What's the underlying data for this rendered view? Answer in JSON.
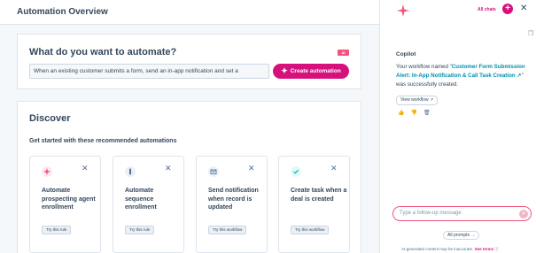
{
  "main": {
    "title": "Automation Overview",
    "automate_card": {
      "title": "What do you want to automate?",
      "ai_badge": "AI",
      "prompt_value": "When an existing customer submits a form, send an in-app notification and set a",
      "create_button": "Create automation"
    },
    "discover": {
      "title": "Discover",
      "subtitle": "Get started with these recommended automations",
      "cards": [
        {
          "label": "Automate prospecting agent enrollment",
          "button": "Try this rule",
          "icon": "sparkle-icon",
          "icon_color": "#f2547d"
        },
        {
          "label": "Automate sequence enrollment",
          "button": "Try this rule",
          "icon": "sequence-icon",
          "icon_color": "#516f90"
        },
        {
          "label": "Send notification when record is updated",
          "button": "Try this workflow",
          "icon": "mail-icon",
          "icon_color": "#7c98b6"
        },
        {
          "label": "Create task when a deal is created",
          "button": "Try this workflow",
          "icon": "task-icon",
          "icon_color": "#00bda5"
        }
      ]
    }
  },
  "panel": {
    "all_chats": "All chats",
    "copilot_label": "Copilot",
    "message_prefix": "Your workflow named \"",
    "workflow_name": "Customer Form Submission Alert: In-App Notification & Call Task Creation",
    "message_suffix": "\" was successfully created.",
    "view_workflow": "View workflow",
    "followup_placeholder": "Type a follow-up message",
    "all_prompts": "All prompts",
    "disclaimer": "AI-generated content may be inaccurate.",
    "see_terms": "See terms"
  },
  "colors": {
    "accent": "#d6117e",
    "link": "#0091ae"
  }
}
